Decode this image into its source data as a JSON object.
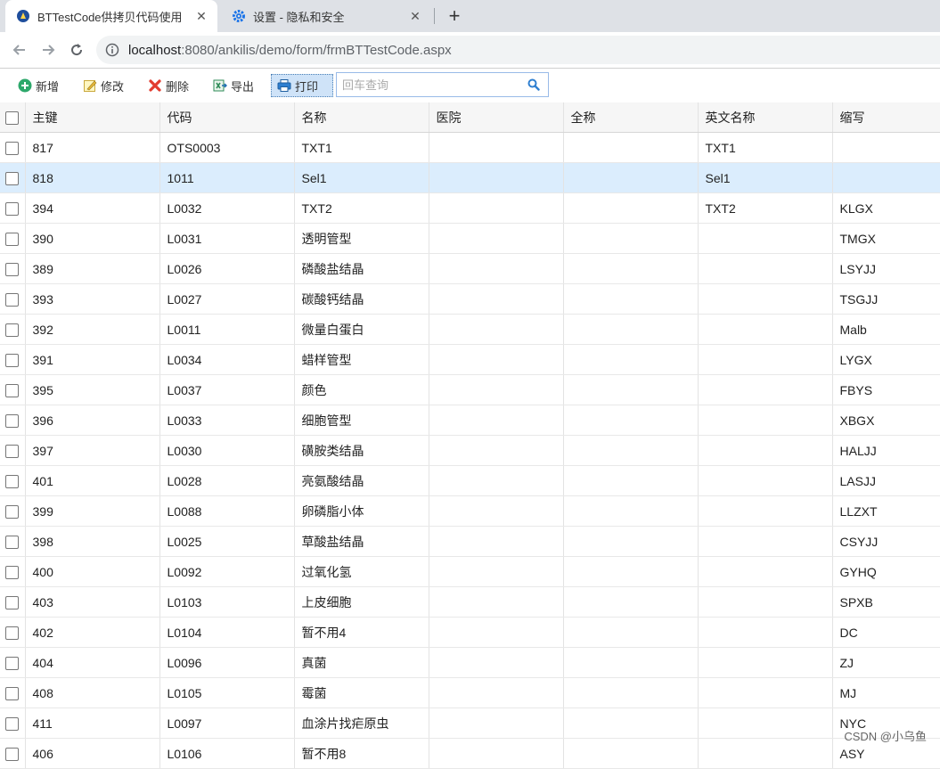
{
  "browser": {
    "tabs": [
      {
        "title": "BTTestCode供拷贝代码使用",
        "active": true
      },
      {
        "title": "设置 - 隐私和安全",
        "active": false
      }
    ],
    "url_host": "localhost",
    "url_path": ":8080/ankilis/demo/form/frmBTTestCode.aspx"
  },
  "toolbar": {
    "add_label": "新增",
    "edit_label": "修改",
    "delete_label": "删除",
    "export_label": "导出",
    "print_label": "打印",
    "search_placeholder": "回车查询"
  },
  "grid": {
    "columns": [
      "主键",
      "代码",
      "名称",
      "医院",
      "全称",
      "英文名称",
      "缩写"
    ],
    "rows": [
      [
        "817",
        "OTS0003",
        "TXT1",
        "",
        "",
        "TXT1",
        ""
      ],
      [
        "818",
        "1011",
        "Sel1",
        "",
        "",
        "Sel1",
        ""
      ],
      [
        "394",
        "L0032",
        "TXT2",
        "",
        "",
        "TXT2",
        "KLGX"
      ],
      [
        "390",
        "L0031",
        "透明管型",
        "",
        "",
        "",
        "TMGX"
      ],
      [
        "389",
        "L0026",
        "磷酸盐结晶",
        "",
        "",
        "",
        "LSYJJ"
      ],
      [
        "393",
        "L0027",
        "碳酸钙结晶",
        "",
        "",
        "",
        "TSGJJ"
      ],
      [
        "392",
        "L0011",
        "微量白蛋白",
        "",
        "",
        "",
        "Malb"
      ],
      [
        "391",
        "L0034",
        "蜡样管型",
        "",
        "",
        "",
        "LYGX"
      ],
      [
        "395",
        "L0037",
        "颜色",
        "",
        "",
        "",
        "FBYS"
      ],
      [
        "396",
        "L0033",
        "细胞管型",
        "",
        "",
        "",
        "XBGX"
      ],
      [
        "397",
        "L0030",
        "磺胺类结晶",
        "",
        "",
        "",
        "HALJJ"
      ],
      [
        "401",
        "L0028",
        "亮氨酸结晶",
        "",
        "",
        "",
        "LASJJ"
      ],
      [
        "399",
        "L0088",
        "卵磷脂小体",
        "",
        "",
        "",
        "LLZXT"
      ],
      [
        "398",
        "L0025",
        "草酸盐结晶",
        "",
        "",
        "",
        "CSYJJ"
      ],
      [
        "400",
        "L0092",
        "过氧化氢",
        "",
        "",
        "",
        "GYHQ"
      ],
      [
        "403",
        "L0103",
        "上皮细胞",
        "",
        "",
        "",
        "SPXB"
      ],
      [
        "402",
        "L0104",
        "暂不用4",
        "",
        "",
        "",
        "DC"
      ],
      [
        "404",
        "L0096",
        "真菌",
        "",
        "",
        "",
        "ZJ"
      ],
      [
        "408",
        "L0105",
        "霉菌",
        "",
        "",
        "",
        "MJ"
      ],
      [
        "411",
        "L0097",
        "血涂片找疟原虫",
        "",
        "",
        "",
        "NYC"
      ],
      [
        "406",
        "L0106",
        "暂不用8",
        "",
        "",
        "",
        "ASY"
      ]
    ],
    "selected_row": 1
  },
  "watermark": "CSDN @小乌鱼",
  "colors": {
    "accent": "#1a73e8",
    "selected_row_bg": "#dbedfd",
    "header_bg": "#f6f6f6"
  }
}
